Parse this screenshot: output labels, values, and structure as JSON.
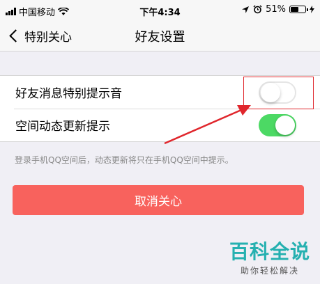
{
  "status_bar": {
    "carrier": "中国移动",
    "time": "下午4:34",
    "battery": "51%",
    "icons": [
      "signal-icon",
      "wifi-icon",
      "location-icon",
      "alarm-icon",
      "battery-icon"
    ]
  },
  "nav": {
    "back_label": "特别关心",
    "title": "好友设置"
  },
  "settings": [
    {
      "label": "好友消息特别提示音",
      "enabled": false
    },
    {
      "label": "空间动态更新提示",
      "enabled": true
    }
  ],
  "hint": "登录手机QQ空间后，动态更新将只在手机QQ空间中提示。",
  "cancel_button": "取消关心",
  "watermark": {
    "main": "百科全说",
    "sub": "助你轻松解决"
  },
  "colors": {
    "toggle_on": "#4cd964",
    "cancel_button": "#f8625d",
    "annotation": "#e0262c",
    "watermark": "#25b0b0"
  }
}
